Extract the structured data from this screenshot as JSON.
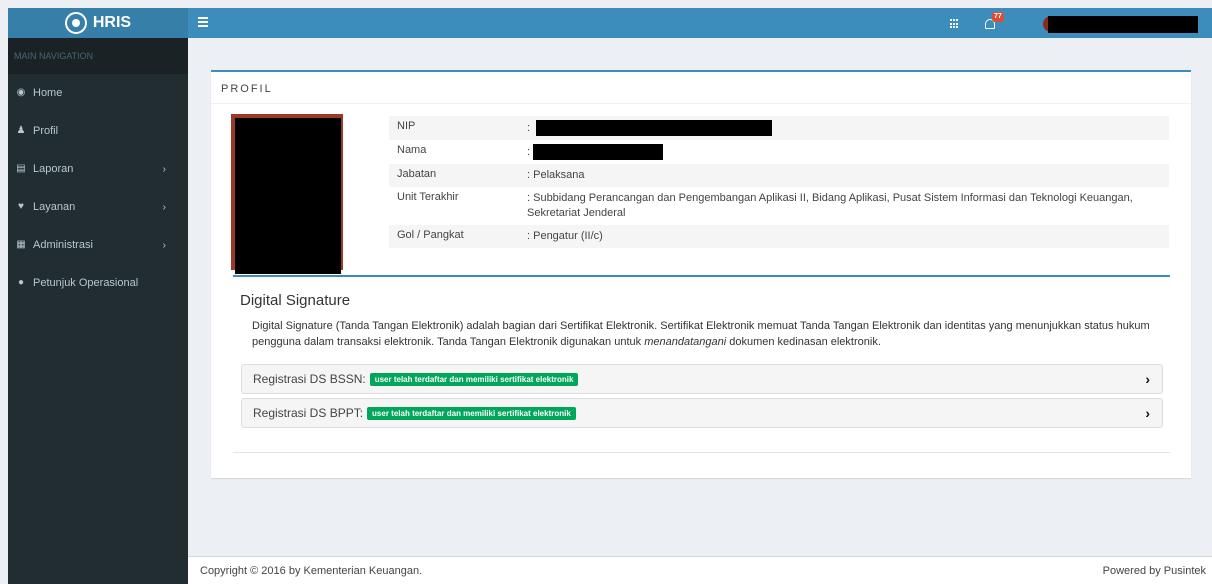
{
  "header": {
    "logo_text": "HRIS",
    "notification_count": "77"
  },
  "sidebar": {
    "section_label": "MAIN NAVIGATION",
    "items": [
      {
        "label": "Home"
      },
      {
        "label": "Profil"
      },
      {
        "label": "Laporan"
      },
      {
        "label": "Layanan"
      },
      {
        "label": "Administrasi"
      },
      {
        "label": "Petunjuk Operasional"
      }
    ]
  },
  "profile": {
    "title": "PROFIL",
    "fields": [
      {
        "label": "NIP",
        "value": ""
      },
      {
        "label": "Nama",
        "value": ""
      },
      {
        "label": "Jabatan",
        "value": ": Pelaksana"
      },
      {
        "label": "Unit Terakhir",
        "value": ": Subbidang Perancangan dan Pengembangan Aplikasi II, Bidang Aplikasi, Pusat Sistem Informasi dan Teknologi Keuangan, Sekretariat Jenderal"
      },
      {
        "label": "Gol / Pangkat",
        "value": ": Pengatur (II/c)"
      }
    ]
  },
  "digital_signature": {
    "title": "Digital Signature",
    "description_part1": "Digital Signature (Tanda Tangan Elektronik) adalah bagian dari Sertifikat Elektronik. Sertifikat Elektronik memuat Tanda Tangan Elektronik dan identitas yang menunjukkan status hukum pengguna dalam transaksi elektronik. Tanda Tangan Elektronik digunakan untuk ",
    "description_emphasis": "menandatangani",
    "description_part2": " dokumen kedinasan elektronik.",
    "registrations": [
      {
        "label": "Registrasi DS BSSN:",
        "badge": "user telah terdaftar dan memiliki sertifikat elektronik"
      },
      {
        "label": "Registrasi DS BPPT:",
        "badge": "user telah terdaftar dan memiliki sertifikat elektronik"
      }
    ]
  },
  "footer": {
    "copyright": "Copyright © 2016 by Kementerian Keuangan.",
    "powered": "Powered by Pusintek"
  },
  "colors": {
    "topbar": "#3c8dbc",
    "logo_bg": "#367fa9",
    "sidebar": "#222d32",
    "badge_green": "#00a65a",
    "notif_red": "#dd4b39"
  },
  "icons": {
    "menu_toggle": "hamburger-icon",
    "apps": "grid-icon",
    "notifications": "bell-icon",
    "home": "dashboard-icon",
    "profil": "user-icon",
    "laporan": "files-icon",
    "layanan": "heart-icon",
    "administrasi": "file-icon",
    "petunjuk": "info-circle-icon",
    "expand": "chevron-right-icon"
  }
}
